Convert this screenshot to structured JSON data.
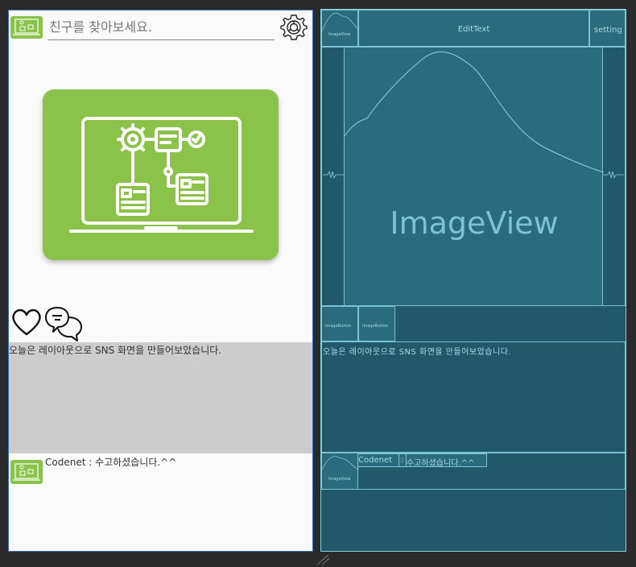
{
  "design": {
    "search_placeholder": "친구를 찾아보세요.",
    "post_text": "오늘은 레이아웃으로 SNS 화면을 만들어보았습니다.",
    "comment_text": "Codenet : 수고하셨습니다.^^"
  },
  "blueprint": {
    "top_image_label": "ImageView",
    "edittext_label": "EditText",
    "setting_label": "setting",
    "main_image_label": "ImageView",
    "image_button_1_label": "ImageButton",
    "image_button_2_label": "ImageButton",
    "post_text": "오늘은 레이아웃으로 SNS 화면을 만들어보았습니다.",
    "comment_icon_label": "ImageView",
    "comment_user": "Codenet",
    "comment_colon": ":",
    "comment_text": "수고하셨습니다.^^"
  },
  "colors": {
    "accent_green": "#8bc34a",
    "blueprint_bg": "#22596a",
    "blueprint_line": "#7ac3d4"
  }
}
